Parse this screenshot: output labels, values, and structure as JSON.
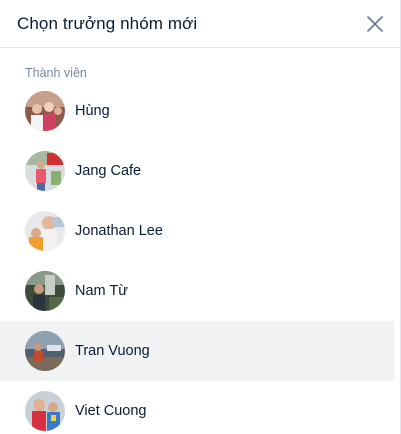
{
  "dialog": {
    "title": "Chọn trưởng nhóm mới",
    "close_icon": "close-icon"
  },
  "members_section": {
    "label": "Thành viên",
    "members": [
      {
        "name": "Hùng",
        "avatar": "photo-avatar",
        "highlighted": false
      },
      {
        "name": "Jang Cafe",
        "avatar": "photo-avatar",
        "highlighted": false
      },
      {
        "name": "Jonathan Lee",
        "avatar": "photo-avatar",
        "highlighted": false
      },
      {
        "name": "Nam Từ",
        "avatar": "photo-avatar",
        "highlighted": false
      },
      {
        "name": "Tran Vuong",
        "avatar": "photo-avatar",
        "highlighted": true
      },
      {
        "name": "Viet Cuong",
        "avatar": "photo-avatar",
        "highlighted": false
      }
    ]
  },
  "colors": {
    "text": "#081c36",
    "muted_text": "#7589a3",
    "divider": "#e4e6eb",
    "hover_row": "#f1f2f4"
  }
}
